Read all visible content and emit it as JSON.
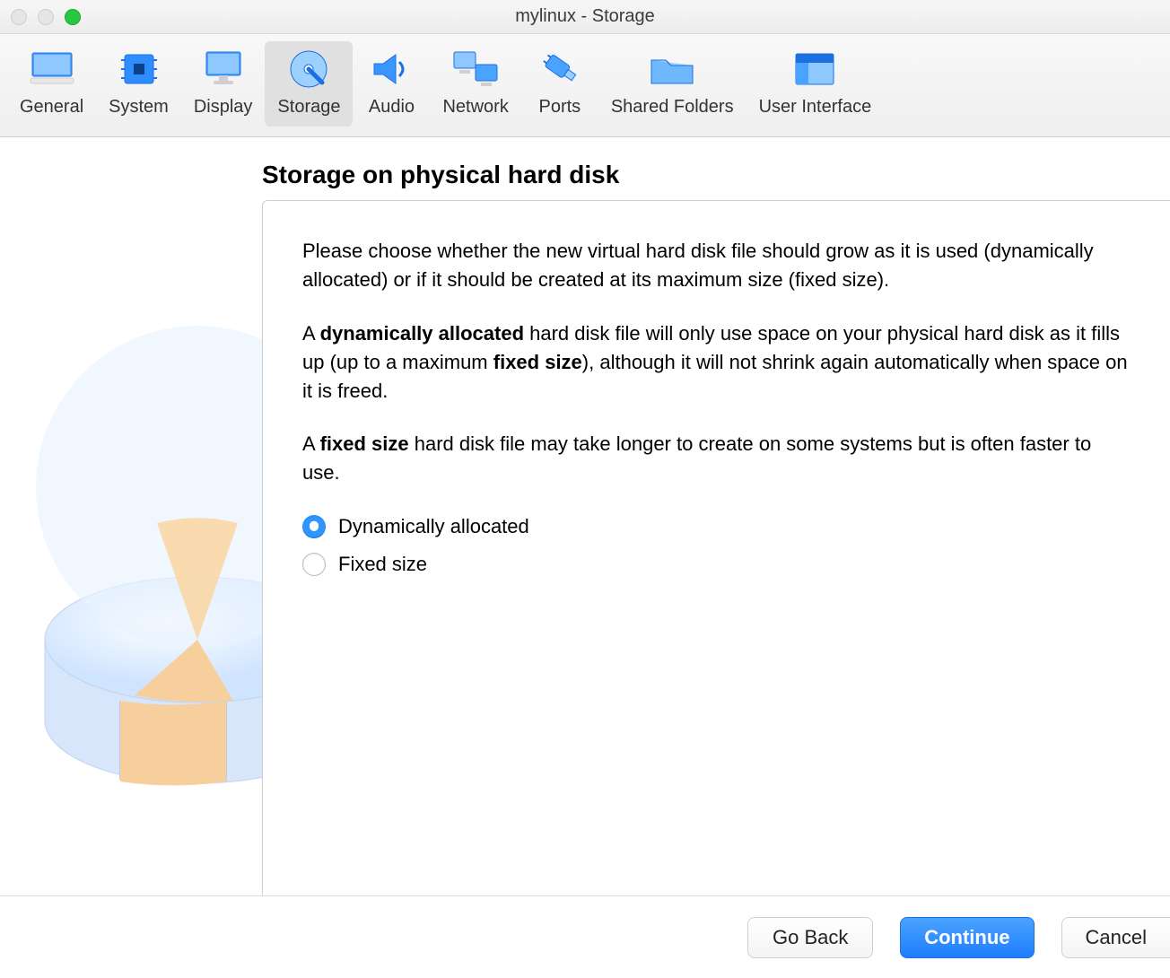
{
  "window": {
    "title": "mylinux - Storage"
  },
  "toolbar": {
    "active": "Storage",
    "items": [
      {
        "id": "general",
        "label": "General"
      },
      {
        "id": "system",
        "label": "System"
      },
      {
        "id": "display",
        "label": "Display"
      },
      {
        "id": "storage",
        "label": "Storage"
      },
      {
        "id": "audio",
        "label": "Audio"
      },
      {
        "id": "network",
        "label": "Network"
      },
      {
        "id": "ports",
        "label": "Ports"
      },
      {
        "id": "shared-folders",
        "label": "Shared Folders"
      },
      {
        "id": "user-interface",
        "label": "User Interface"
      }
    ]
  },
  "heading": "Storage on physical hard disk",
  "body": {
    "p1": "Please choose whether the new virtual hard disk file should grow as it is used (dynamically allocated) or if it should be created at its maximum size (fixed size).",
    "p2_a": "A ",
    "p2_bold1": "dynamically allocated",
    "p2_b": " hard disk file will only use space on your physical hard disk as it fills up (up to a maximum ",
    "p2_bold2": "fixed size",
    "p2_c": "), although it will not shrink again automatically when space on it is freed.",
    "p3_a": "A ",
    "p3_bold": "fixed size",
    "p3_b": " hard disk file may take longer to create on some systems but is often faster to use."
  },
  "options": {
    "selected": 0,
    "items": [
      {
        "label": "Dynamically allocated"
      },
      {
        "label": "Fixed size"
      }
    ]
  },
  "buttons": {
    "back": "Go Back",
    "continue": "Continue",
    "cancel": "Cancel"
  }
}
